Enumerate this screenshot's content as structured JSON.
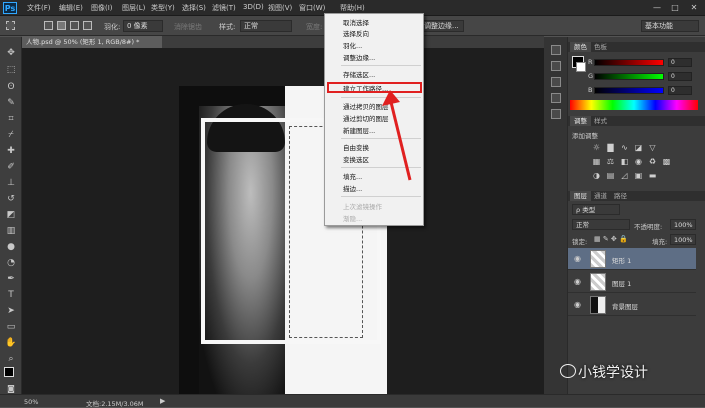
{
  "menubar": {
    "logo": "Ps",
    "items": [
      "文件(F)",
      "编辑(E)",
      "图像(I)",
      "图层(L)",
      "类型(Y)",
      "选择(S)",
      "滤镜(T)",
      "3D(D)",
      "视图(V)",
      "窗口(W)",
      "帮助(H)"
    ],
    "minimize": "—",
    "maximize": "□",
    "close": "✕"
  },
  "options": {
    "feather_label": "羽化:",
    "feather_value": "0 像素",
    "antialias": "消除锯齿",
    "style_label": "样式:",
    "style_value": "正常",
    "width_label": "宽度:",
    "edge_button": "调整边缘...",
    "workspace": "基本功能"
  },
  "doc_tab": "人物.psd @ 50% (矩形 1, RGB/8#) *",
  "context_menu": {
    "items": [
      "取消选择",
      "选择反向",
      "羽化...",
      "调整边缘...",
      "存储选区...",
      "建立工作路径...",
      "通过拷贝的图层",
      "通过剪切的图层",
      "新建图层...",
      "自由变换",
      "变换选区",
      "填充...",
      "描边...",
      "上次滤镜操作",
      "渐隐..."
    ],
    "highlighted": "建立工作路径...",
    "disabled": [
      "上次滤镜操作",
      "渐隐..."
    ]
  },
  "color_panel": {
    "tabs": [
      "颜色",
      "色板"
    ],
    "r_label": "R",
    "g_label": "G",
    "b_label": "B",
    "r": "0",
    "g": "0",
    "b": "0"
  },
  "adjust_panel": {
    "tabs": [
      "调整",
      "样式"
    ],
    "title": "添加调整"
  },
  "layers_panel": {
    "tabs": [
      "图层",
      "通道",
      "路径"
    ],
    "filter": "ρ 类型",
    "blend": "正常",
    "opacity_label": "不透明度:",
    "opacity": "100%",
    "lock_label": "锁定:",
    "fill_label": "填充:",
    "fill": "100%",
    "layers": [
      {
        "name": "矩形 1",
        "selected": true
      },
      {
        "name": "图层 1",
        "selected": false
      },
      {
        "name": "背景图层",
        "selected": false
      }
    ]
  },
  "status": {
    "zoom": "50%",
    "doc": "文档:2.15M/3.06M"
  },
  "watermark": "小钱学设计",
  "colors": {
    "highlight_box": "#e02020",
    "arrow": "#e02020"
  }
}
